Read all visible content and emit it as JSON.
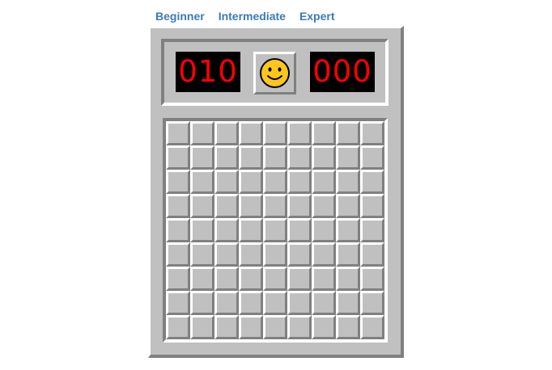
{
  "menu": {
    "beginner": "Beginner",
    "intermediate": "Intermediate",
    "expert": "Expert"
  },
  "game": {
    "mine_counter": "010",
    "timer": "000",
    "face": "smiley-face-icon",
    "rows": 9,
    "cols": 9
  },
  "colors": {
    "menu_link": "#3a7ab8",
    "panel_gray": "#c0c0c0",
    "digit_red": "#ff0000",
    "face_yellow": "#ffc61e"
  }
}
